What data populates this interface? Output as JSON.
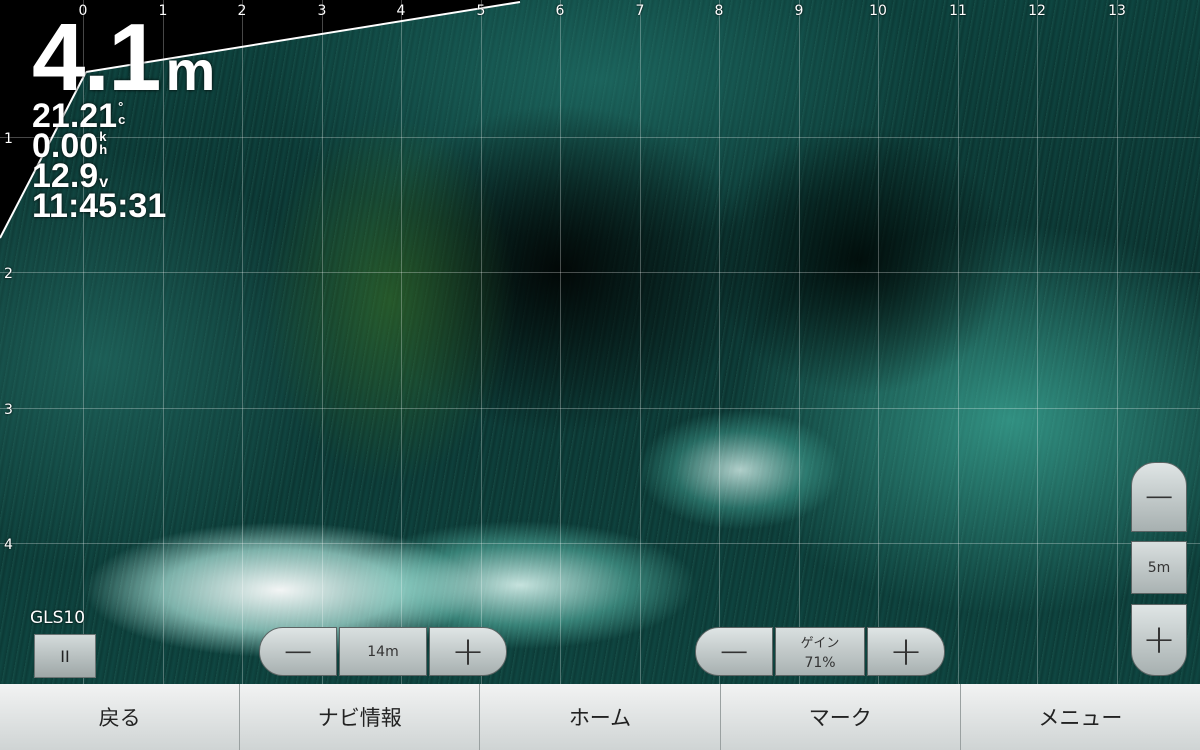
{
  "readouts": {
    "depth_value": "4.1",
    "depth_unit": "m",
    "temperature": "21.21",
    "temperature_unit_top": "°",
    "temperature_unit_bottom": "c",
    "speed": "0.00",
    "speed_unit_top": "k",
    "speed_unit_bottom": "h",
    "voltage": "12.9",
    "voltage_unit": "v",
    "time": "11:45:31"
  },
  "grid": {
    "x_ticks": [
      "0",
      "1",
      "2",
      "3",
      "4",
      "5",
      "6",
      "7",
      "8",
      "9",
      "10",
      "11",
      "12",
      "13"
    ],
    "y_ticks": [
      "1",
      "2",
      "3",
      "4"
    ]
  },
  "source": {
    "label": "GLS10",
    "pause_symbol": "II"
  },
  "range_control": {
    "minus": "−",
    "value": "14m",
    "plus": "+"
  },
  "gain_control": {
    "minus": "−",
    "label": "ゲイン",
    "value": "71%",
    "plus": "+"
  },
  "zoom_control": {
    "minus": "−",
    "value": "5m",
    "plus": "+"
  },
  "navbar": {
    "back": "戻る",
    "nav_info": "ナビ情報",
    "home": "ホーム",
    "mark": "マーク",
    "menu": "メニュー"
  },
  "colors": {
    "sonar_base": "#0b3a36",
    "sonar_return": "#5ad0c0",
    "bottom_echo": "#ffffff",
    "fish_green": "#5a9a2e",
    "button_face": "#c6cdcd"
  }
}
